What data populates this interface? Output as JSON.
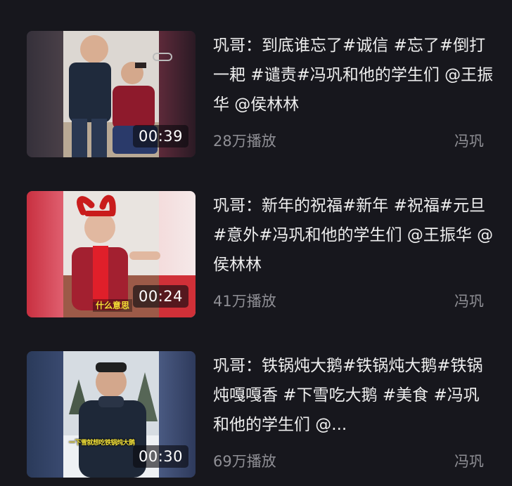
{
  "videos": [
    {
      "title": "巩哥：到底谁忘了#诚信 #忘了#倒打一耙 #谴责#冯巩和他的学生们 @王振华 @侯林林",
      "duration": "00:39",
      "views": "28万播放",
      "author": "冯巩"
    },
    {
      "title": "巩哥：新年的祝福#新年 #祝福#元旦 #意外#冯巩和他的学生们 @王振华 @侯林林",
      "duration": "00:24",
      "views": "41万播放",
      "author": "冯巩",
      "thumb_caption": "什么意思"
    },
    {
      "title": "巩哥：铁锅炖大鹅#铁锅炖大鹅#铁锅炖嘎嘎香 #下雪吃大鹅 #美食 #冯巩和他的学生们 @...",
      "duration": "00:30",
      "views": "69万播放",
      "author": "冯巩",
      "thumb_caption": "一下雪就想吃铁锅炖大鹅"
    }
  ],
  "colors": {
    "background": "#17171d",
    "title_text": "#eeeeee",
    "meta_text": "#8f8f95",
    "caption_yellow": "#f3df35"
  }
}
